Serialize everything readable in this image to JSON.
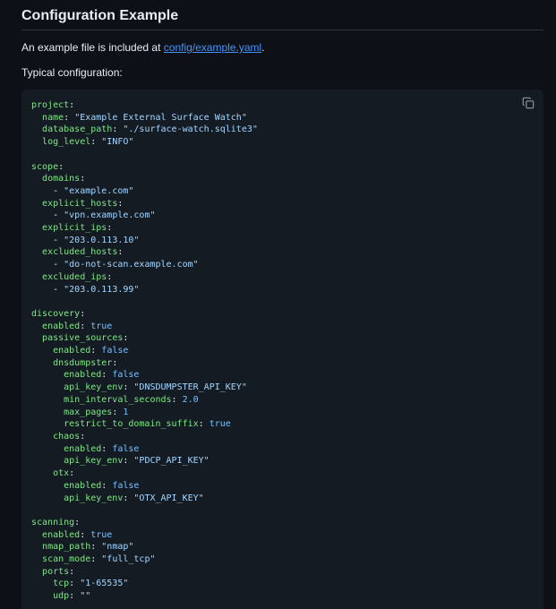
{
  "section": {
    "title": "Configuration Example",
    "intro_text": "An example file is included at ",
    "intro_link": "config/example.yaml",
    "intro_suffix": ".",
    "typical_label": "Typical configuration:"
  },
  "code_block": {
    "copy_icon": "copy-icon",
    "lines": [
      {
        "indent": 0,
        "key": "project",
        "sep": ":",
        "value": "",
        "kind": ""
      },
      {
        "indent": 2,
        "key": "name",
        "sep": ": ",
        "value": "\"Example External Surface Watch\"",
        "kind": "s"
      },
      {
        "indent": 2,
        "key": "database_path",
        "sep": ": ",
        "value": "\"./surface-watch.sqlite3\"",
        "kind": "s"
      },
      {
        "indent": 2,
        "key": "log_level",
        "sep": ": ",
        "value": "\"INFO\"",
        "kind": "s"
      },
      {
        "indent": 0,
        "key": "",
        "sep": "",
        "value": "",
        "kind": ""
      },
      {
        "indent": 0,
        "key": "scope",
        "sep": ":",
        "value": "",
        "kind": ""
      },
      {
        "indent": 2,
        "key": "domains",
        "sep": ":",
        "value": "",
        "kind": ""
      },
      {
        "indent": 4,
        "key": "",
        "sep": "- ",
        "value": "\"example.com\"",
        "kind": "s"
      },
      {
        "indent": 2,
        "key": "explicit_hosts",
        "sep": ":",
        "value": "",
        "kind": ""
      },
      {
        "indent": 4,
        "key": "",
        "sep": "- ",
        "value": "\"vpn.example.com\"",
        "kind": "s"
      },
      {
        "indent": 2,
        "key": "explicit_ips",
        "sep": ":",
        "value": "",
        "kind": ""
      },
      {
        "indent": 4,
        "key": "",
        "sep": "- ",
        "value": "\"203.0.113.10\"",
        "kind": "s"
      },
      {
        "indent": 2,
        "key": "excluded_hosts",
        "sep": ":",
        "value": "",
        "kind": ""
      },
      {
        "indent": 4,
        "key": "",
        "sep": "- ",
        "value": "\"do-not-scan.example.com\"",
        "kind": "s"
      },
      {
        "indent": 2,
        "key": "excluded_ips",
        "sep": ":",
        "value": "",
        "kind": ""
      },
      {
        "indent": 4,
        "key": "",
        "sep": "- ",
        "value": "\"203.0.113.99\"",
        "kind": "s"
      },
      {
        "indent": 0,
        "key": "",
        "sep": "",
        "value": "",
        "kind": ""
      },
      {
        "indent": 0,
        "key": "discovery",
        "sep": ":",
        "value": "",
        "kind": ""
      },
      {
        "indent": 2,
        "key": "enabled",
        "sep": ": ",
        "value": "true",
        "kind": "b"
      },
      {
        "indent": 2,
        "key": "passive_sources",
        "sep": ":",
        "value": "",
        "kind": ""
      },
      {
        "indent": 4,
        "key": "enabled",
        "sep": ": ",
        "value": "false",
        "kind": "b"
      },
      {
        "indent": 4,
        "key": "dnsdumpster",
        "sep": ":",
        "value": "",
        "kind": ""
      },
      {
        "indent": 6,
        "key": "enabled",
        "sep": ": ",
        "value": "false",
        "kind": "b"
      },
      {
        "indent": 6,
        "key": "api_key_env",
        "sep": ": ",
        "value": "\"DNSDUMPSTER_API_KEY\"",
        "kind": "s"
      },
      {
        "indent": 6,
        "key": "min_interval_seconds",
        "sep": ": ",
        "value": "2.0",
        "kind": "b"
      },
      {
        "indent": 6,
        "key": "max_pages",
        "sep": ": ",
        "value": "1",
        "kind": "b"
      },
      {
        "indent": 6,
        "key": "restrict_to_domain_suffix",
        "sep": ": ",
        "value": "true",
        "kind": "b"
      },
      {
        "indent": 4,
        "key": "chaos",
        "sep": ":",
        "value": "",
        "kind": ""
      },
      {
        "indent": 6,
        "key": "enabled",
        "sep": ": ",
        "value": "false",
        "kind": "b"
      },
      {
        "indent": 6,
        "key": "api_key_env",
        "sep": ": ",
        "value": "\"PDCP_API_KEY\"",
        "kind": "s"
      },
      {
        "indent": 4,
        "key": "otx",
        "sep": ":",
        "value": "",
        "kind": ""
      },
      {
        "indent": 6,
        "key": "enabled",
        "sep": ": ",
        "value": "false",
        "kind": "b"
      },
      {
        "indent": 6,
        "key": "api_key_env",
        "sep": ": ",
        "value": "\"OTX_API_KEY\"",
        "kind": "s"
      },
      {
        "indent": 0,
        "key": "",
        "sep": "",
        "value": "",
        "kind": ""
      },
      {
        "indent": 0,
        "key": "scanning",
        "sep": ":",
        "value": "",
        "kind": ""
      },
      {
        "indent": 2,
        "key": "enabled",
        "sep": ": ",
        "value": "true",
        "kind": "b"
      },
      {
        "indent": 2,
        "key": "nmap_path",
        "sep": ": ",
        "value": "\"nmap\"",
        "kind": "s"
      },
      {
        "indent": 2,
        "key": "scan_mode",
        "sep": ": ",
        "value": "\"full_tcp\"",
        "kind": "s"
      },
      {
        "indent": 2,
        "key": "ports",
        "sep": ":",
        "value": "",
        "kind": ""
      },
      {
        "indent": 4,
        "key": "tcp",
        "sep": ": ",
        "value": "\"1-65535\"",
        "kind": "s"
      },
      {
        "indent": 4,
        "key": "udp",
        "sep": ": ",
        "value": "\"\"",
        "kind": "s"
      }
    ]
  },
  "colors": {
    "background": "#0d1117",
    "code_background": "#151b23",
    "yaml_key": "#7ee787",
    "yaml_string": "#a5d6ff",
    "yaml_literal": "#79c0ff",
    "link": "#4493f8"
  }
}
